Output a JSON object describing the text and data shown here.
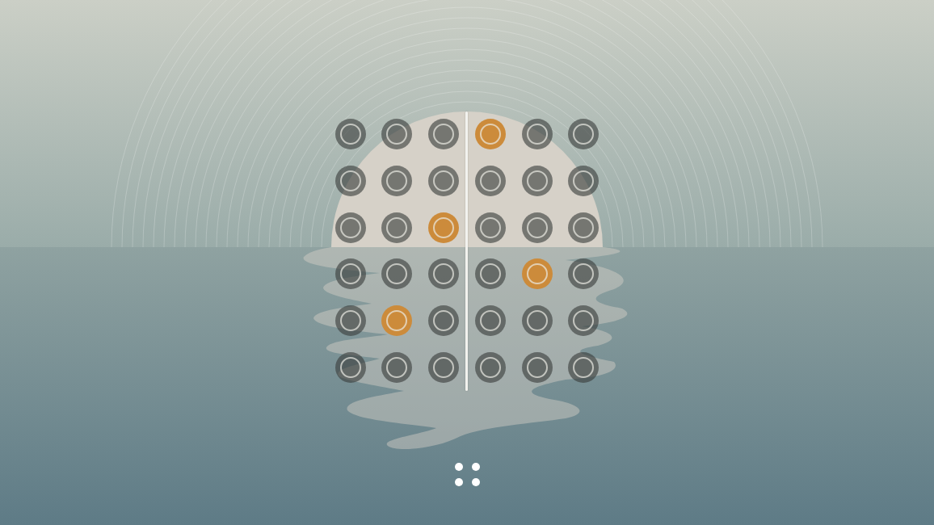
{
  "grid": {
    "rows": [
      {
        "cells": [
          {
            "selected": false
          },
          {
            "selected": false
          },
          {
            "selected": false
          },
          {
            "selected": true
          },
          {
            "selected": false
          },
          {
            "selected": false
          }
        ]
      },
      {
        "cells": [
          {
            "selected": false
          },
          {
            "selected": false
          },
          {
            "selected": false
          },
          {
            "selected": false
          },
          {
            "selected": false
          },
          {
            "selected": false
          }
        ]
      },
      {
        "cells": [
          {
            "selected": false
          },
          {
            "selected": false
          },
          {
            "selected": true
          },
          {
            "selected": false
          },
          {
            "selected": false
          },
          {
            "selected": false
          }
        ]
      },
      {
        "cells": [
          {
            "selected": false
          },
          {
            "selected": false
          },
          {
            "selected": false
          },
          {
            "selected": false
          },
          {
            "selected": true
          },
          {
            "selected": false
          }
        ]
      },
      {
        "cells": [
          {
            "selected": false
          },
          {
            "selected": true
          },
          {
            "selected": false
          },
          {
            "selected": false
          },
          {
            "selected": false
          },
          {
            "selected": false
          }
        ]
      },
      {
        "cells": [
          {
            "selected": false
          },
          {
            "selected": false
          },
          {
            "selected": false
          },
          {
            "selected": false
          },
          {
            "selected": false
          },
          {
            "selected": false
          }
        ]
      }
    ]
  },
  "playhead": {
    "level": 0.5
  }
}
